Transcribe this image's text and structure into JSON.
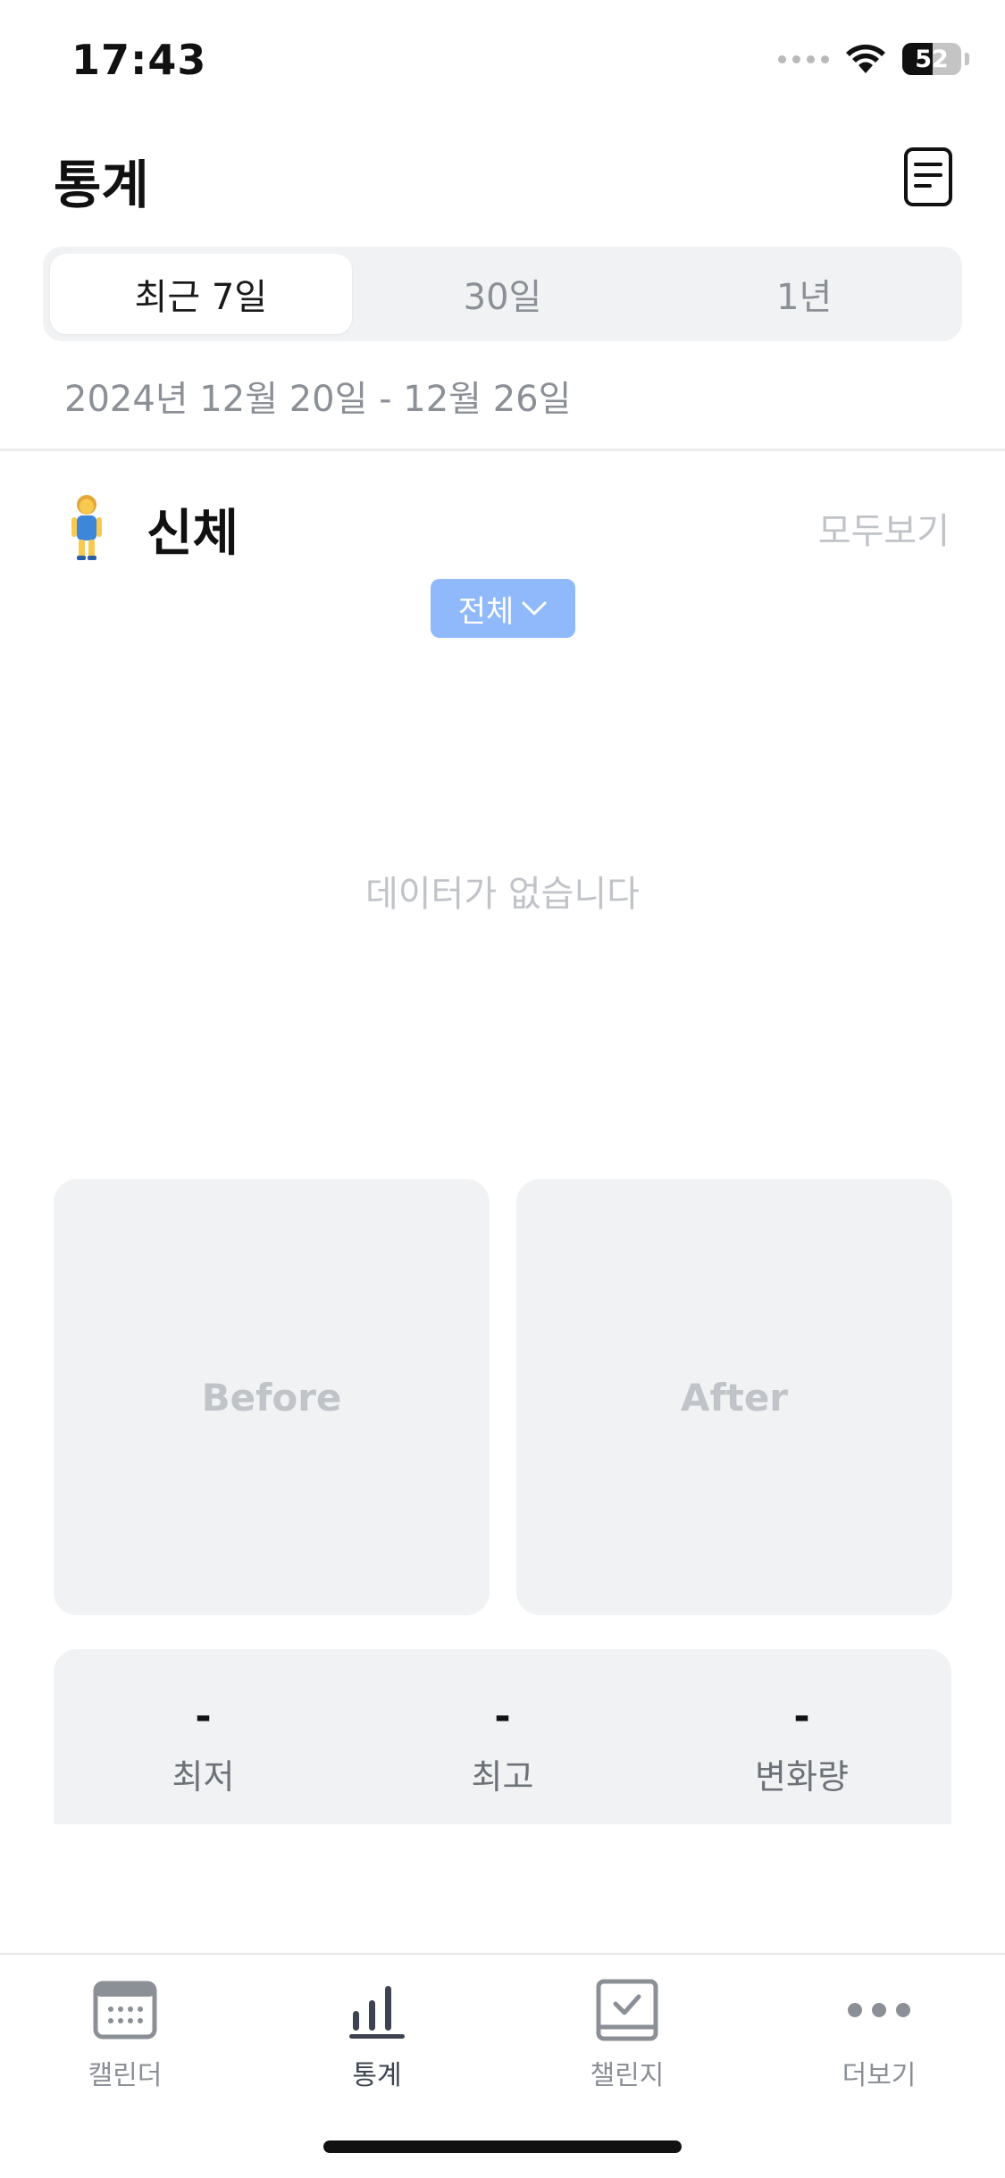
{
  "status_bar": {
    "time": "17:43",
    "battery_level": "52",
    "battery_fraction": 0.52
  },
  "header": {
    "title": "통계",
    "report_icon": "report-document-icon"
  },
  "period_tabs": [
    {
      "label": "최근 7일",
      "selected": true
    },
    {
      "label": "30일",
      "selected": false
    },
    {
      "label": "1년",
      "selected": false
    }
  ],
  "date_range": "2024년 12월 20일  -  12월 26일",
  "body_section": {
    "icon": "person-standing-emoji",
    "title": "신체",
    "view_all_label": "모두보기",
    "filter": {
      "selected_label": "전체",
      "icon": "chevron-down-icon"
    },
    "empty_message": "데이터가 없습니다",
    "photos": {
      "before_label": "Before",
      "after_label": "After"
    },
    "stats": [
      {
        "value": "-",
        "label": "최저"
      },
      {
        "value": "-",
        "label": "최고"
      },
      {
        "value": "-",
        "label": "변화량"
      }
    ]
  },
  "tab_bar": {
    "items": [
      {
        "label": "캘린더",
        "icon": "calendar-icon",
        "active": false
      },
      {
        "label": "통계",
        "icon": "bar-chart-icon",
        "active": true
      },
      {
        "label": "챌린지",
        "icon": "checkbox-icon",
        "active": false
      },
      {
        "label": "더보기",
        "icon": "more-dots-icon",
        "active": false
      }
    ]
  },
  "colors": {
    "accent_chip": "#8fb9fa",
    "card_background": "#f1f2f4",
    "muted_text": "#c0c3c8",
    "secondary_text": "#8b8f96"
  }
}
